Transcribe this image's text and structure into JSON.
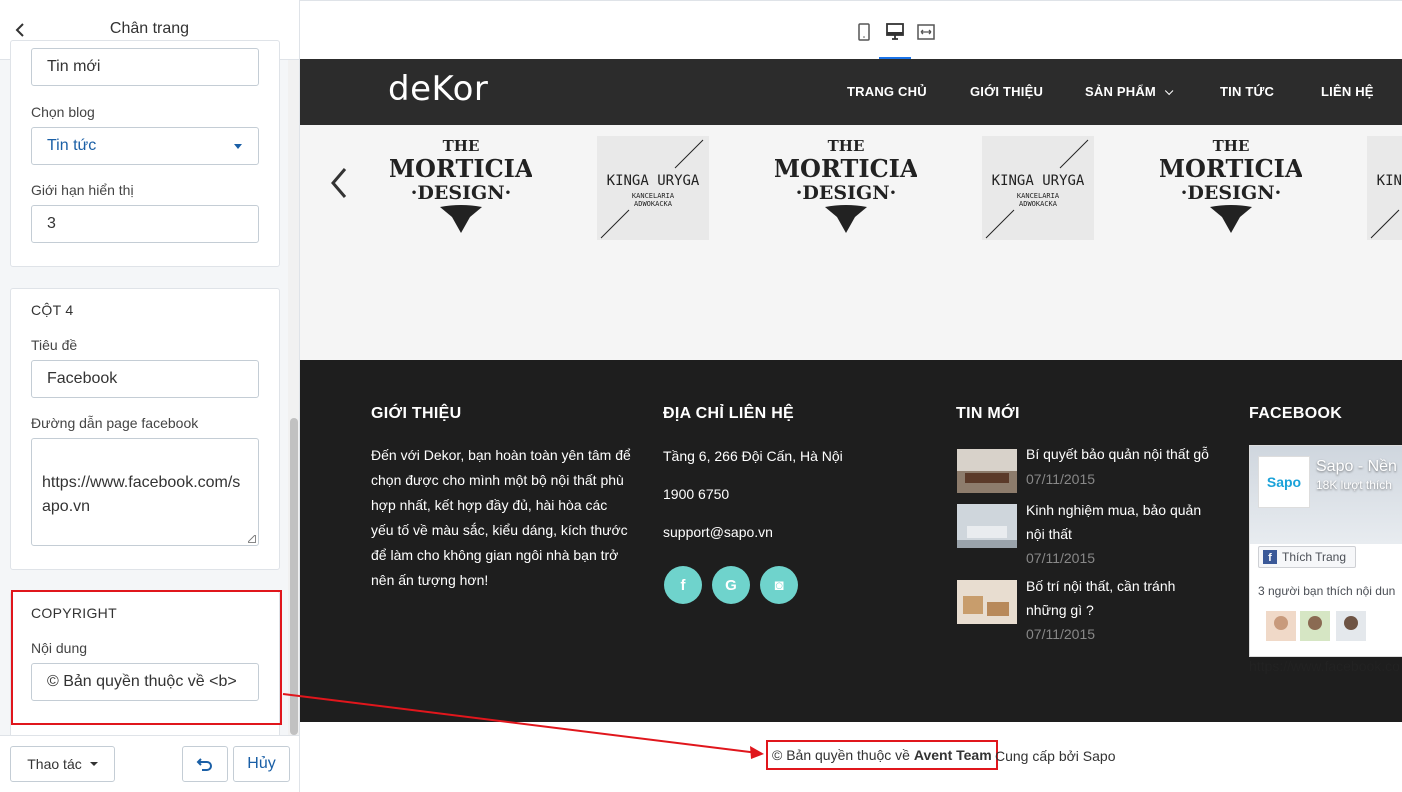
{
  "panel": {
    "title": "Chân trang",
    "blog_col": {
      "name_value": "Tin mới",
      "blog_label": "Chọn blog",
      "blog_value": "Tin tức",
      "limit_label": "Giới hạn hiển thị",
      "limit_value": "3"
    },
    "col4": {
      "heading": "CỘT 4",
      "title_label": "Tiêu đề",
      "title_value": "Facebook",
      "fb_url_label": "Đường dẫn page facebook",
      "fb_url_value": "https://www.facebook.com/sapo.vn"
    },
    "copyright": {
      "heading": "COPYRIGHT",
      "content_label": "Nội dung",
      "content_value": "© Bản quyền thuộc về <b>"
    },
    "footer": {
      "actions_label": "Thao tác",
      "cancel_label": "Hủy"
    }
  },
  "site": {
    "logo": "deKor",
    "nav": [
      "TRANG CHỦ",
      "GIỚI THIỆU",
      "SẢN PHẨM",
      "TIN TỨC",
      "LIÊN HỆ"
    ],
    "brands": [
      {
        "l1": "THE",
        "l2": "MORTICIA",
        "l3": "·DESIGN·"
      },
      {
        "l1": "KINGA URYGA",
        "l2": "KANCELARIA",
        "l3": "ADWOKACKA"
      }
    ],
    "footer": {
      "about_title": "GIỚI THIỆU",
      "about_text": "Đến với Dekor, bạn hoàn toàn yên tâm để chọn được cho mình một bộ nội thất phù hợp nhất, kết hợp đầy đủ, hài hòa các yếu tố về màu sắc, kiểu dáng, kích thước để làm cho không gian ngôi nhà bạn trở nên ấn tượng hơn!",
      "contact_title": "ĐỊA CHỈ LIÊN HỆ",
      "address": "Tầng 6, 266 Đội Cấn, Hà Nội",
      "phone": "1900 6750",
      "email": "support@sapo.vn",
      "social": [
        "f",
        "G",
        "◙"
      ],
      "news_title": "TIN MỚI",
      "news": [
        {
          "title": "Bí quyết bảo quản nội thất gỗ",
          "date": "07/11/2015"
        },
        {
          "title": "Kinh nghiệm mua, bảo quản nội thất",
          "date": "07/11/2015"
        },
        {
          "title": "Bố trí nội thất, cần tránh những gì ?",
          "date": "07/11/2015"
        }
      ],
      "facebook_title": "FACEBOOK",
      "fb": {
        "logo": "Sapo",
        "page_name": "Sapo - Nền",
        "likes": "18K lượt thích",
        "like_button": "Thích Trang",
        "friends": "3 người bạn thích nội dun",
        "url": "https://www.facebook.co"
      }
    },
    "copyright": {
      "prefix": "© Bản quyền thuộc về ",
      "owner": "Avent Team",
      "suffix": "Cung cấp bởi Sapo"
    }
  },
  "colors": {
    "accent": "#1a73e8",
    "social": "#6fd3cc",
    "highlight": "#e0161c",
    "header_bg": "#2c2c2c",
    "footer_bg": "#1e1e1e"
  }
}
